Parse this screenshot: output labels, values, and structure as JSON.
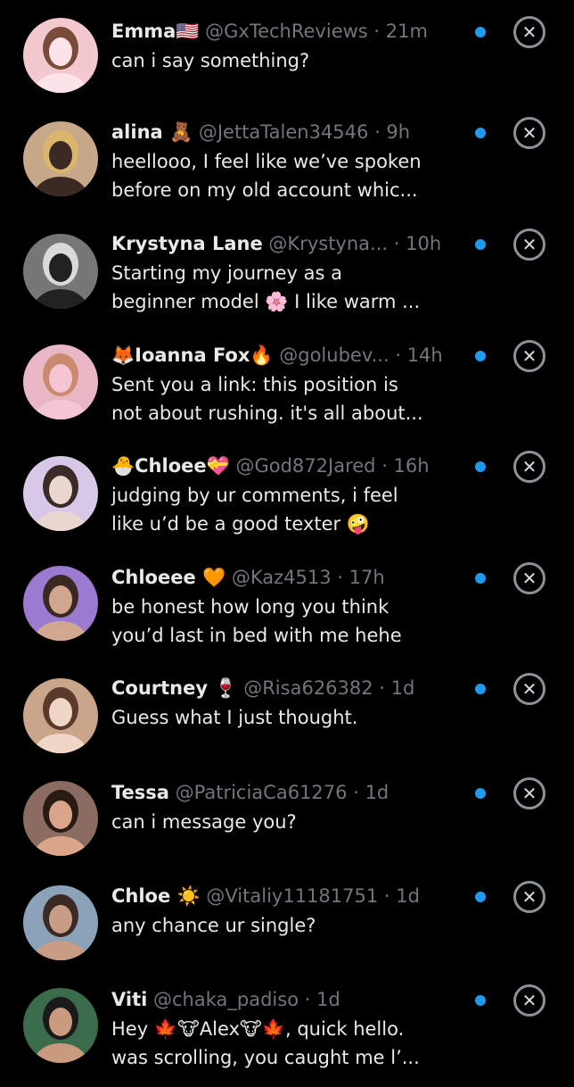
{
  "colors": {
    "background": "#000000",
    "text": "#e7e9ea",
    "muted": "#71767b",
    "unread_dot": "#1d9bf0"
  },
  "requests": [
    {
      "name": "Emma🇺🇸",
      "handle": "@GxTechReviews",
      "time": "· 21m",
      "lines": [
        "can i say something?"
      ]
    },
    {
      "name": "alina 🧸",
      "handle": "@JettaTalen34546",
      "time": "· 9h",
      "lines": [
        "heellooo, I feel like we’ve spoken",
        "before on my old account whic..."
      ]
    },
    {
      "name": "Krystyna Lane",
      "handle": "@Krystyna...",
      "time": "· 10h",
      "lines": [
        "Starting my journey as a",
        "beginner model 🌸 I like warm ..."
      ]
    },
    {
      "name": "🦊Ioanna Fox🔥",
      "handle": "@golubev...",
      "time": "· 14h",
      "lines": [
        "Sent you a link: this position is",
        "not about rushing. it's all about..."
      ]
    },
    {
      "name": "🐣Chloee💝",
      "handle": "@God872Jared",
      "time": "· 16h",
      "lines": [
        "judging by ur comments, i feel",
        "like u’d be a good texter 🤪"
      ]
    },
    {
      "name": "Chloeee 🧡",
      "handle": "@Kaz4513",
      "time": "· 17h",
      "lines": [
        "be honest how long you think",
        "you’d last in bed with me hehe"
      ]
    },
    {
      "name": "Courtney 🍷",
      "handle": "@Risa626382",
      "time": "· 1d",
      "lines": [
        "Guess what I just thought."
      ]
    },
    {
      "name": "Tessa",
      "handle": "@PatriciaCa61276",
      "time": "· 1d",
      "lines": [
        "can i message you?"
      ]
    },
    {
      "name": "Chloe ☀️",
      "handle": "@Vitaliy11181751",
      "time": "· 1d",
      "lines": [
        "any chance ur single?"
      ]
    },
    {
      "name": "Viti",
      "handle": "@chaka_padiso",
      "time": "· 1d",
      "lines": [
        "Hey 🍁🐮Alex🐮🍁, quick hello.",
        "was scrolling, you caught me l’..."
      ]
    }
  ],
  "icons": {
    "close": "close-x-circle-icon",
    "unread": "unread-dot"
  }
}
